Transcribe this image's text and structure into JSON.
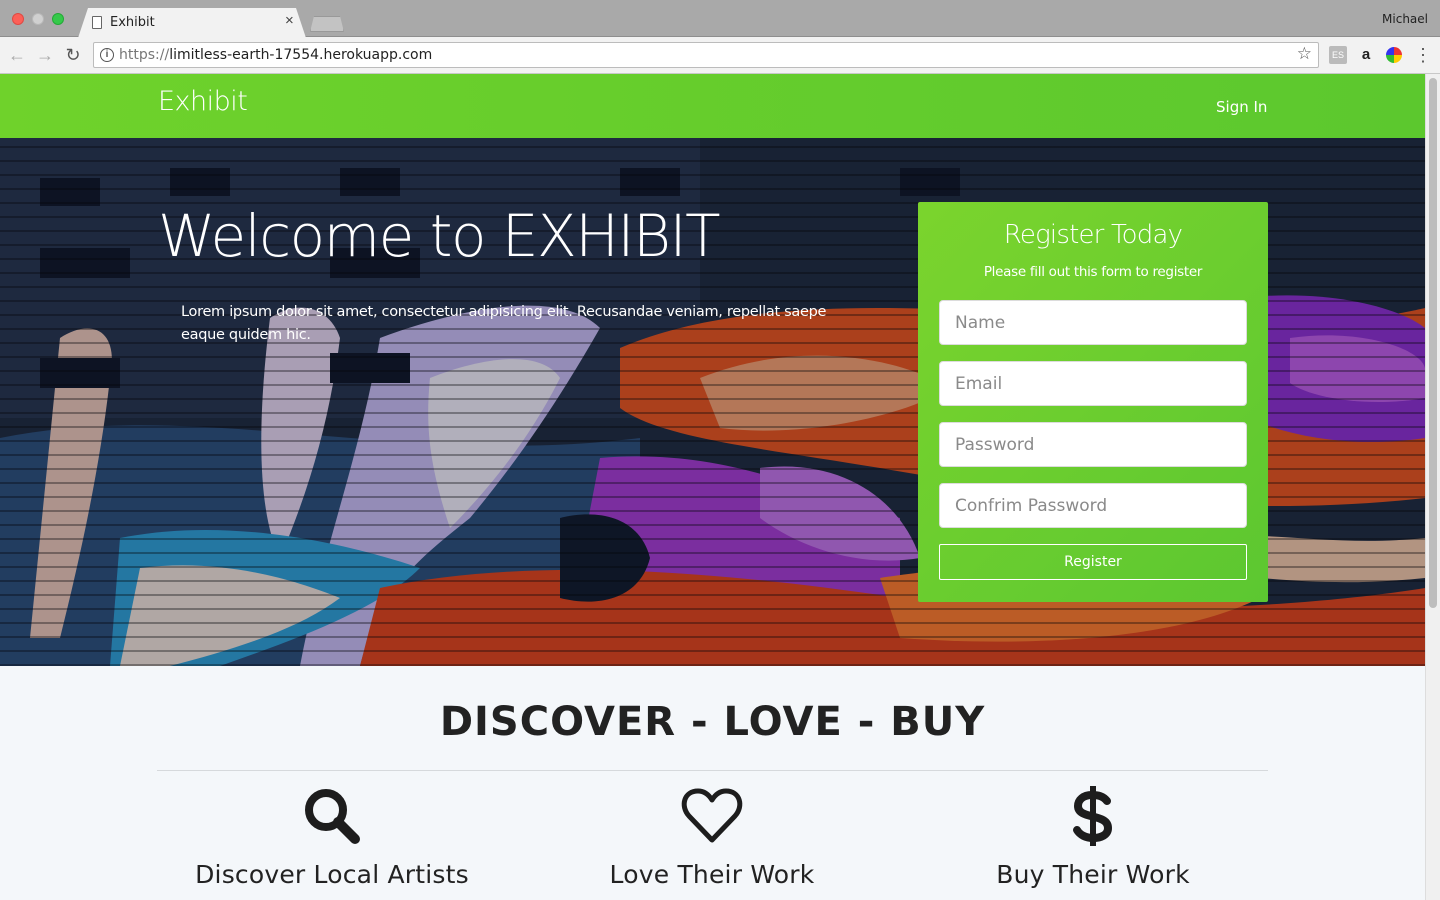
{
  "browser": {
    "tab_title": "Exhibit",
    "tab_close": "×",
    "user_name": "Michael",
    "url_scheme": "https://",
    "url_host": "limitless-earth-17554.herokuapp.com",
    "ext_icon_1": "ES",
    "ext_icon_2": "a"
  },
  "navbar": {
    "brand": "Exhibit",
    "signin": "Sign In",
    "background_color": "#6fd22b"
  },
  "hero": {
    "title": "Welcome to EXHIBIT",
    "text": "Lorem ipsum dolor sit amet, consectetur adipisicing elit. Recusandae veniam, repellat saepe eaque quidem hic."
  },
  "register": {
    "title": "Register Today",
    "subtitle": "Please fill out this form to register",
    "name_placeholder": "Name",
    "email_placeholder": "Email",
    "password_placeholder": "Password",
    "confirm_placeholder": "Confrim Password",
    "button_label": "Register"
  },
  "features": {
    "heading": "DISCOVER - LOVE - BUY",
    "items": [
      {
        "icon": "search-icon",
        "label": "Discover Local Artists"
      },
      {
        "icon": "heart-icon",
        "label": "Love Their Work"
      },
      {
        "icon": "dollar-icon",
        "label": "Buy Their Work"
      }
    ]
  }
}
